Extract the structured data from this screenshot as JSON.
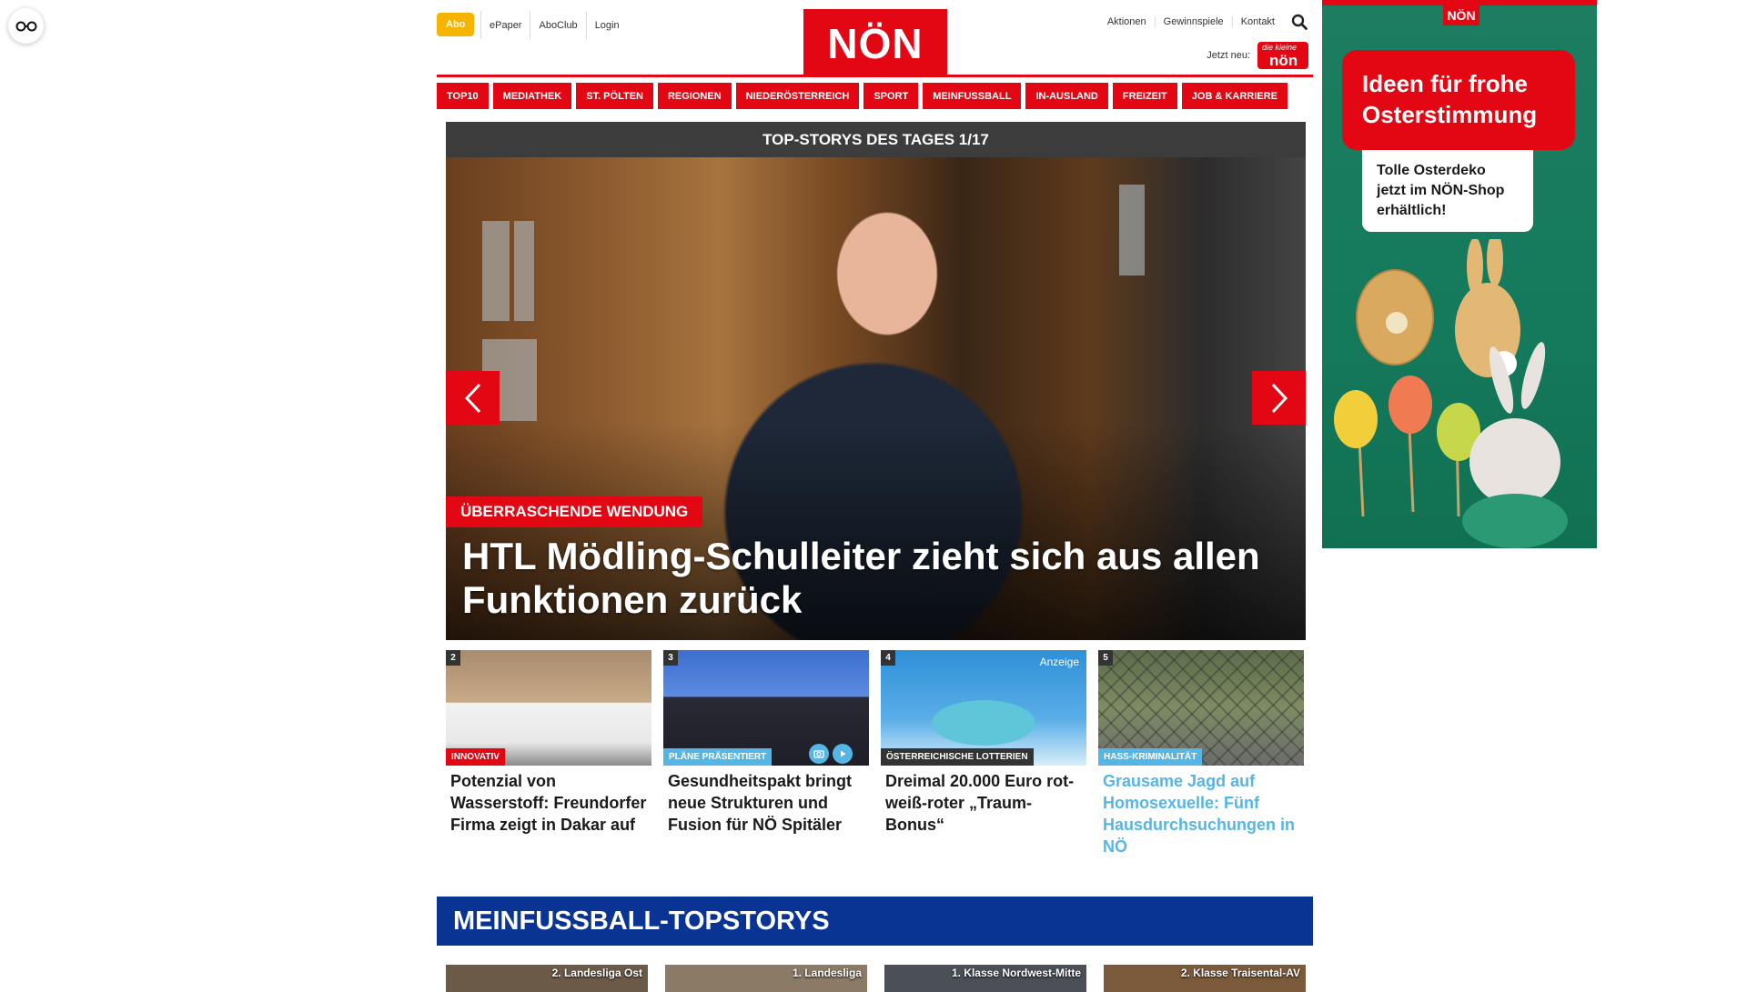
{
  "header": {
    "abo_label": "Abo",
    "top_links": [
      "ePaper",
      "AboClub",
      "Login"
    ],
    "logo_text": "NÖN",
    "right_links": [
      "Aktionen",
      "Gewinnspiele",
      "Kontakt"
    ],
    "jetzt_neu_label": "Jetzt neu:",
    "badge_small": "die kleine",
    "badge_big": "nön"
  },
  "nav": {
    "items": [
      "TOP10",
      "MEDIATHEK",
      "ST. PÖLTEN",
      "REGIONEN",
      "NIEDERÖSTERREICH",
      "SPORT",
      "MEINFUSSBALL",
      "IN-AUSLAND",
      "FREIZEIT",
      "JOB & KARRIERE"
    ]
  },
  "slider": {
    "bar_title": "TOP-STORYS DES TAGES 1/17",
    "kicker": "ÜBERRASCHENDE WENDUNG",
    "title": "HTL Mödling-Schulleiter zieht sich aus allen Funktionen zurück"
  },
  "stories": [
    {
      "num": "2",
      "tag": "INNOVATIV",
      "tag_color": "#e30613",
      "title": "Potenzial von Wasserstoff: Freundorfer Firma zeigt in Dakar auf",
      "sponsored": ""
    },
    {
      "num": "3",
      "tag": "PLÄNE PRÄSENTIERT",
      "tag_color": "#55b6e6",
      "title": "Gesundheitspakt bringt neue Strukturen und Fusion für NÖ Spitäler",
      "sponsored": ""
    },
    {
      "num": "4",
      "tag": "ÖSTERREICHISCHE LOTTERIEN",
      "tag_color": "#333333",
      "title": "Dreimal 20.000 Euro rot-weiß-roter „Traum-Bonus“",
      "sponsored": "Anzeige"
    },
    {
      "num": "5",
      "tag": "HASS-KRIMINALITÄT",
      "tag_color": "#55b6e6",
      "title": "Grausame Jagd auf Homosexuelle: Fünf Hausdurchsuchungen in NÖ",
      "sponsored": ""
    }
  ],
  "meinfussball": {
    "title": "MEINFUSSBALL-TOPSTORYS",
    "leagues": [
      "2. Landesliga Ost",
      "1. Landesliga",
      "1. Klasse Nordwest-Mitte",
      "2. Klasse Traisental-AV"
    ]
  },
  "ad": {
    "logo": "NÖN",
    "headline": "Ideen für frohe Osterstimmung",
    "subline": "Tolle Osterdeko jetzt im NÖN-Shop erhältlich!"
  }
}
